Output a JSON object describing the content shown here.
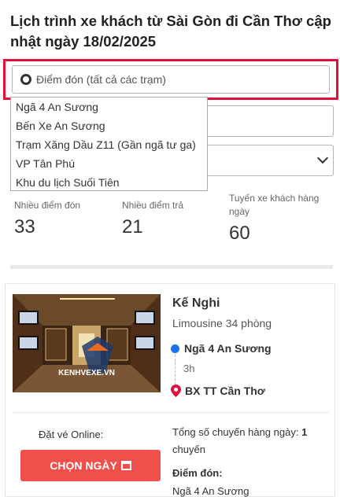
{
  "page": {
    "title": "Lịch trình xe khách từ Sài Gòn đi Cần Thơ cập nhật ngày 18/02/2025"
  },
  "pickup": {
    "placeholder": "Điểm đón (tất cả các trạm)",
    "options": [
      "Ngã 4 An Sương",
      "Bến Xe An Sương",
      "Trạm Xăng Dầu Z11 (Gần ngã tư ga)",
      "VP Tân Phú",
      "Khu du lịch Suối Tiên"
    ]
  },
  "stats": [
    {
      "label": "Nhiều điểm đón",
      "value": "33"
    },
    {
      "label": "Nhiều điểm trả",
      "value": "21"
    },
    {
      "label": "Tuyến xe khách hàng ngày",
      "value": "60"
    }
  ],
  "card": {
    "image_watermark": "KENHVEXE.VN",
    "operator": "Kế Nghi",
    "bus_type": "Limousine 34 phòng",
    "from": "Ngã 4 An Sương",
    "duration": "3h",
    "to": "BX TT Cần Thơ",
    "book_label": "Đặt vé Online:",
    "choose_button": "CHỌN NGÀY",
    "trips_label": "Tổng số chuyến hàng ngày:",
    "trips_count": "1",
    "trips_unit": "chuyến",
    "pickup_title": "Điểm đón:",
    "pickup_value": "Ngã 4 An Sương"
  },
  "colors": {
    "highlight": "#e0103a",
    "button": "#f0504b",
    "from_dot": "#1a73e8",
    "pin": "#e0103a"
  }
}
